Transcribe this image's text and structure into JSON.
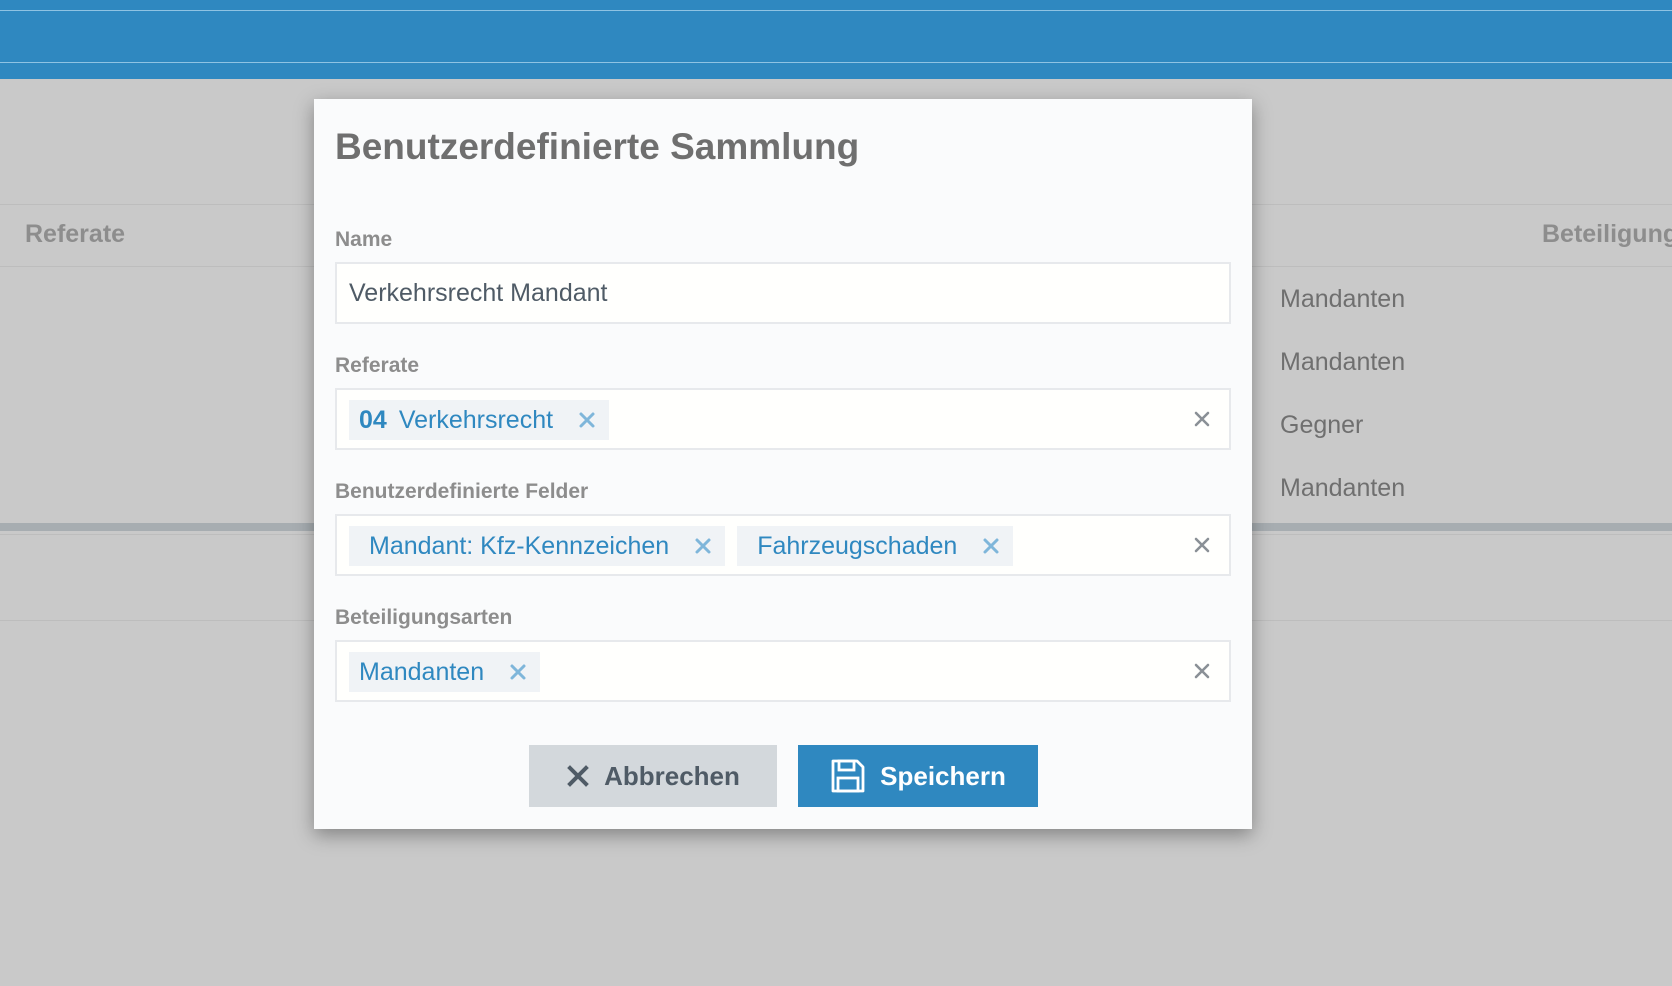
{
  "background": {
    "columns": {
      "referate": "Referate",
      "beteiligung": "Beteiligung"
    },
    "rows": [
      "Mandanten",
      "Mandanten",
      "Gegner",
      "Mandanten"
    ]
  },
  "dialog": {
    "title": "Benutzerdefinierte Sammlung",
    "name": {
      "label": "Name",
      "value": "Verkehrsrecht Mandant"
    },
    "referate": {
      "label": "Referate",
      "tags": [
        {
          "code": "04",
          "label": "Verkehrsrecht"
        }
      ]
    },
    "felder": {
      "label": "Benutzerdefinierte Felder",
      "tags": [
        {
          "label": "Mandant: Kfz-Kennzeichen"
        },
        {
          "label": "Fahrzeugschaden"
        }
      ]
    },
    "beteiligungsarten": {
      "label": "Beteiligungsarten",
      "tags": [
        {
          "label": "Mandanten"
        }
      ]
    },
    "buttons": {
      "cancel_label": "Abbrechen",
      "save_label": "Speichern"
    }
  },
  "icons": {
    "tag_remove": "close-icon",
    "field_clear": "clear-icon",
    "cancel": "x-icon",
    "save": "floppy-disk-icon"
  },
  "colors": {
    "brand": "#2f88c0",
    "cancel_button": "#d3d8dc",
    "overlay": "#c9c9c9"
  }
}
